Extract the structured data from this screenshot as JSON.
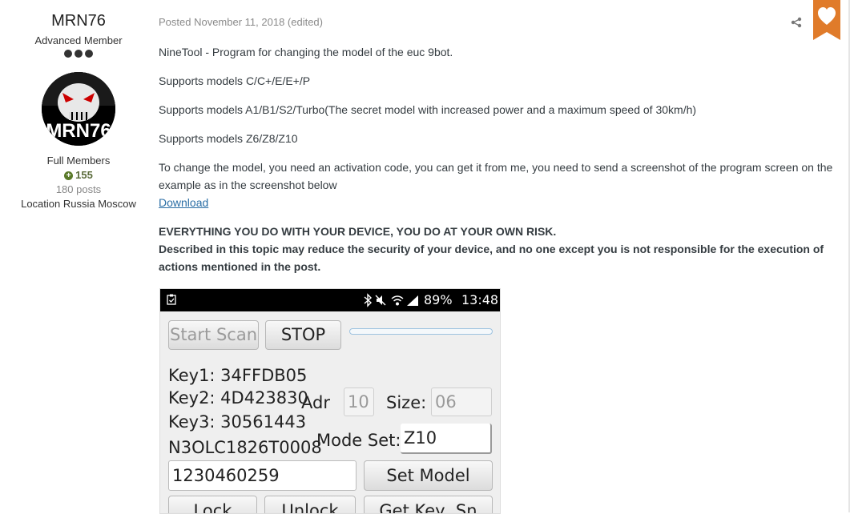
{
  "author": {
    "name": "MRN76",
    "title": "Advanced Member",
    "avatar_text": "MRN76",
    "group": "Full Members",
    "reputation": "155",
    "posts": "180 posts",
    "location": "Location Russia Moscow"
  },
  "post": {
    "meta": "Posted November 11, 2018 (edited)",
    "paragraphs": [
      "NineTool - Program for changing the model of the euc 9bot.",
      "Supports models C/C+/E/E+/P",
      "Supports models A1/B1/S2/Turbo(The secret model with increased power and a maximum speed of 30km/h)",
      "Supports models Z6/Z8/Z10",
      "To change the model, you need an activation code, you can get it from me, you need to send a screenshot of the program screen on the example as in the screenshot below"
    ],
    "download_link": "Download",
    "warning_line1": "EVERYTHING YOU DO WITH YOUR DEVICE, YOU DO AT YOUR OWN RISK.",
    "warning_line2": "Described in this topic may reduce the security of your device, and no one except you is not responsible for the execution of actions mentioned in the post."
  },
  "icons": {
    "share": "share-icon",
    "badge": "heart-icon",
    "accent": "#e07b2a"
  },
  "screenshot": {
    "status": {
      "battery": "89%",
      "time": "13:48"
    },
    "start_scan": "Start Scan",
    "stop": "STOP",
    "key1": "Key1: 34FFDB05",
    "key2": "Key2: 4D423830",
    "key3": "Key3: 30561443",
    "serial": "N3OLC1826T0008",
    "adr_label": "Adr",
    "adr_value": "10",
    "size_label": "Size:",
    "size_value": "06",
    "mode_label": "Mode Set:",
    "mode_value": "Z10",
    "code_value": "1230460259",
    "set_model": "Set Model",
    "lock": "Lock",
    "unlock": "Unlock",
    "get_key": "Get Key, Sn"
  }
}
